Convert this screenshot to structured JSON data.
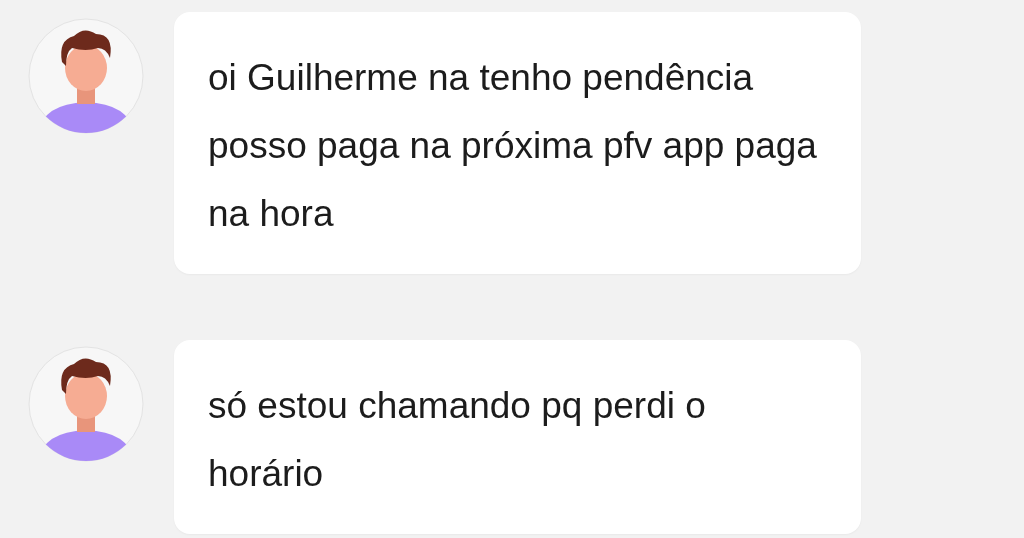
{
  "messages": [
    {
      "text": "oi Guilherme na tenho pendência posso paga na próxima pfv app paga na hora"
    },
    {
      "text": "só estou chamando pq perdi o horário"
    }
  ]
}
